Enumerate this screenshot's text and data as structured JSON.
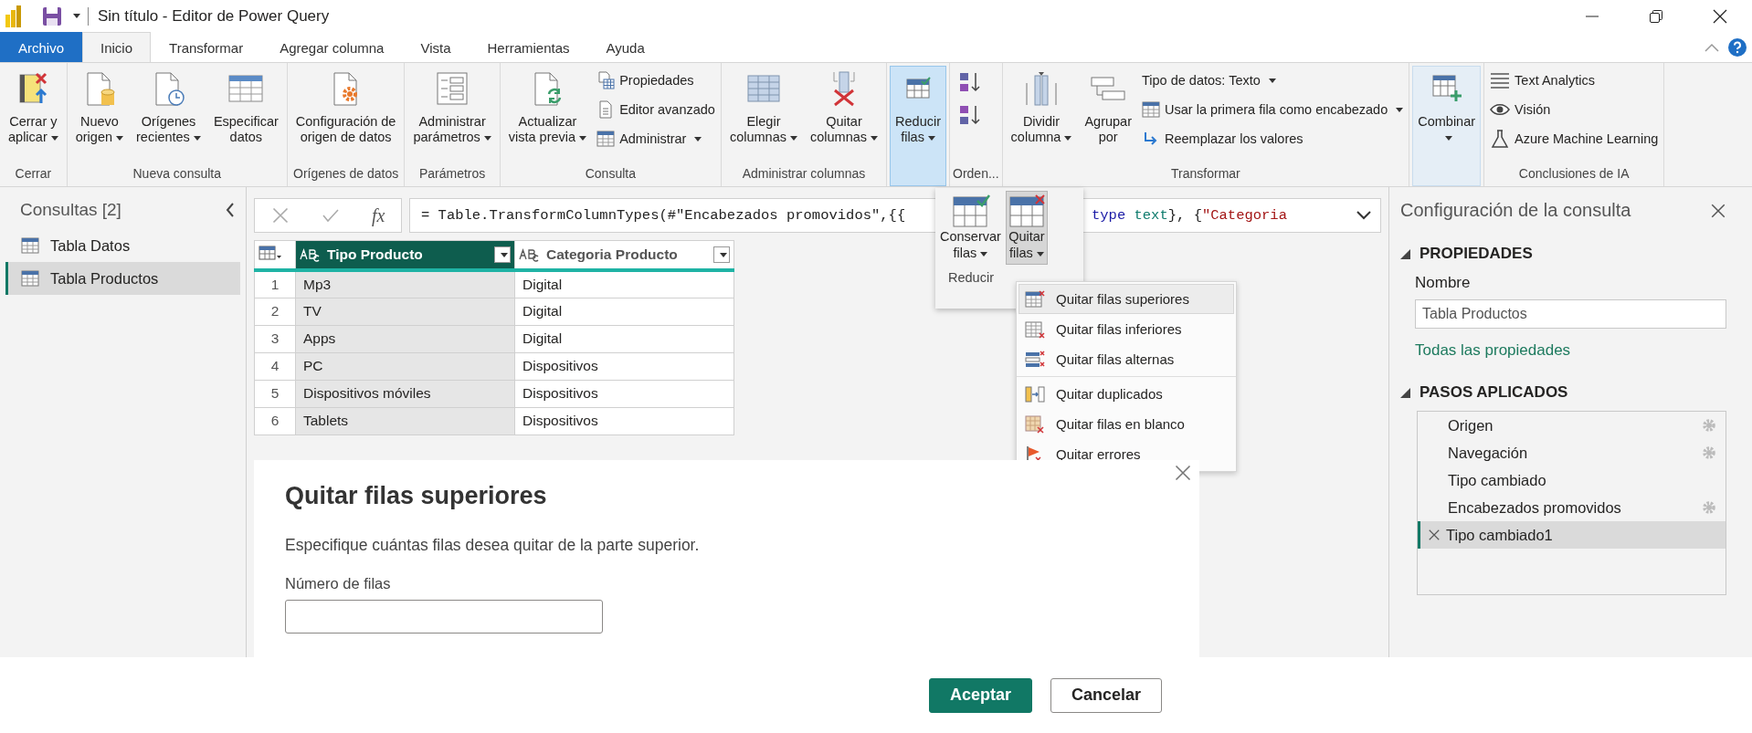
{
  "window": {
    "title": "Sin título - Editor de Power Query"
  },
  "tabs": [
    {
      "label": "Archivo",
      "kind": "file",
      "selected": false
    },
    {
      "label": "Inicio",
      "kind": "tab",
      "selected": true
    },
    {
      "label": "Transformar",
      "kind": "tab",
      "selected": false
    },
    {
      "label": "Agregar columna",
      "kind": "tab",
      "selected": false
    },
    {
      "label": "Vista",
      "kind": "tab",
      "selected": false
    },
    {
      "label": "Herramientas",
      "kind": "tab",
      "selected": false
    },
    {
      "label": "Ayuda",
      "kind": "tab",
      "selected": false
    }
  ],
  "ribbon": [
    {
      "label": "Cerrar",
      "items": [
        {
          "kind": "large",
          "label": "Cerrar y\naplicar",
          "dropdown": true,
          "pressed": false
        }
      ]
    },
    {
      "label": "Nueva consulta",
      "items": [
        {
          "kind": "large",
          "label": "Nuevo\norigen",
          "dropdown": true,
          "pressed": false
        },
        {
          "kind": "large",
          "label": "Orígenes\nrecientes",
          "dropdown": true,
          "pressed": false
        },
        {
          "kind": "large",
          "label": "Especificar\ndatos",
          "dropdown": false,
          "pressed": false
        }
      ]
    },
    {
      "label": "Orígenes de datos",
      "items": [
        {
          "kind": "large",
          "label": "Configuración de\norigen de datos",
          "dropdown": false,
          "pressed": false
        }
      ]
    },
    {
      "label": "Parámetros",
      "items": [
        {
          "kind": "large",
          "label": "Administrar\nparámetros",
          "dropdown": true,
          "pressed": false
        }
      ]
    },
    {
      "label": "Consulta",
      "items": [
        {
          "kind": "large",
          "label": "Actualizar\nvista previa",
          "dropdown": true,
          "pressed": false
        },
        {
          "kind": "small",
          "label": "Propiedades",
          "dropdown": false
        },
        {
          "kind": "small",
          "label": "Editor avanzado",
          "dropdown": false
        },
        {
          "kind": "small",
          "label": "Administrar",
          "dropdown": true
        }
      ]
    },
    {
      "label": "Administrar columnas",
      "items": [
        {
          "kind": "large",
          "label": "Elegir\ncolumnas",
          "dropdown": true,
          "pressed": false
        },
        {
          "kind": "large",
          "label": "Quitar\ncolumnas",
          "dropdown": true,
          "pressed": false
        }
      ]
    },
    {
      "items": [
        {
          "kind": "large",
          "label": "Reducir\nfilas",
          "dropdown": true,
          "pressed": true
        }
      ]
    },
    {
      "label": "Orden...",
      "items": [
        {
          "kind": "icon"
        },
        {
          "kind": "icon"
        }
      ]
    },
    {
      "label": "Transformar",
      "items": [
        {
          "kind": "large",
          "label": "Dividir\ncolumna",
          "dropdown": true,
          "pressed": false
        },
        {
          "kind": "large",
          "label": "Agrupar\npor",
          "dropdown": false,
          "pressed": false
        },
        {
          "kind": "small",
          "label": "Tipo de datos: Texto",
          "dropdown": true
        },
        {
          "kind": "small",
          "label": "Usar la primera fila como encabezado",
          "dropdown": true
        },
        {
          "kind": "small",
          "label": "Reemplazar los valores",
          "dropdown": false
        }
      ]
    },
    {
      "items": [
        {
          "kind": "large",
          "label": "Combinar",
          "dropdown": true,
          "pressed": true
        }
      ]
    },
    {
      "label": "Conclusiones de IA",
      "items": [
        {
          "kind": "small",
          "label": "Text Analytics",
          "dropdown": false
        },
        {
          "kind": "small",
          "label": "Visión",
          "dropdown": false
        },
        {
          "kind": "small",
          "label": "Azure Machine Learning",
          "dropdown": false
        }
      ]
    }
  ],
  "queries": {
    "title": "Consultas [2]",
    "items": [
      {
        "label": "Tabla Datos",
        "selected": false
      },
      {
        "label": "Tabla Productos",
        "selected": true
      }
    ]
  },
  "formula_bar": {
    "fx": "fx",
    "before": [
      {
        "kind": "plain",
        "text": "= Table.TransformColumnTypes(#\"Encabezados promovidos\",{{"
      }
    ],
    "after": [
      {
        "kind": "keyword",
        "text": "type"
      },
      {
        "kind": "type",
        "text": " text"
      },
      {
        "kind": "plain",
        "text": "}, {"
      },
      {
        "kind": "string",
        "text": "\"Categoria"
      }
    ]
  },
  "table": {
    "columns": [
      {
        "label": "Tipo Producto",
        "selected": true
      },
      {
        "label": "Categoria Producto",
        "selected": false
      }
    ],
    "rows": [
      {
        "number": "1",
        "cells": [
          "Mp3",
          "Digital"
        ]
      },
      {
        "number": "2",
        "cells": [
          "TV",
          "Digital"
        ]
      },
      {
        "number": "3",
        "cells": [
          "Apps",
          "Digital"
        ]
      },
      {
        "number": "4",
        "cells": [
          "PC",
          "Dispositivos"
        ]
      },
      {
        "number": "5",
        "cells": [
          "Dispositivos móviles",
          "Dispositivos"
        ]
      },
      {
        "number": "6",
        "cells": [
          "Tablets",
          "Dispositivos"
        ]
      }
    ]
  },
  "settings": {
    "title": "Configuración de la consulta",
    "properties_heading": "PROPIEDADES",
    "name_label": "Nombre",
    "name_value": "Tabla Productos",
    "all_properties_link": "Todas las propiedades",
    "steps_heading": "PASOS APLICADOS",
    "steps": [
      {
        "label": "Origen",
        "has_settings": true,
        "selected": false
      },
      {
        "label": "Navegación",
        "has_settings": true,
        "selected": false
      },
      {
        "label": "Tipo cambiado",
        "has_settings": false,
        "selected": false
      },
      {
        "label": "Encabezados promovidos",
        "has_settings": true,
        "selected": false
      },
      {
        "label": "Tipo cambiado1",
        "has_settings": false,
        "selected": true
      }
    ]
  },
  "reduce_popup": {
    "label": "Reducir",
    "buttons": [
      {
        "label": "Conservar\nfilas",
        "dropdown": true,
        "pressed": false
      },
      {
        "label": "Quitar\nfilas",
        "dropdown": true,
        "pressed": true
      }
    ]
  },
  "remove_menu": {
    "sections": [
      [
        {
          "label": "Quitar filas superiores",
          "selected": true
        },
        {
          "label": "Quitar filas inferiores",
          "selected": false
        },
        {
          "label": "Quitar filas alternas",
          "selected": false
        }
      ],
      [
        {
          "label": "Quitar duplicados",
          "selected": false
        },
        {
          "label": "Quitar filas en blanco",
          "selected": false
        },
        {
          "label": "Quitar errores",
          "selected": false
        }
      ]
    ]
  },
  "dialog": {
    "title": "Quitar filas superiores",
    "description": "Especifique cuántas filas desea quitar de la parte superior.",
    "field_label": "Número de filas",
    "ok": "Aceptar",
    "cancel": "Cancelar"
  }
}
